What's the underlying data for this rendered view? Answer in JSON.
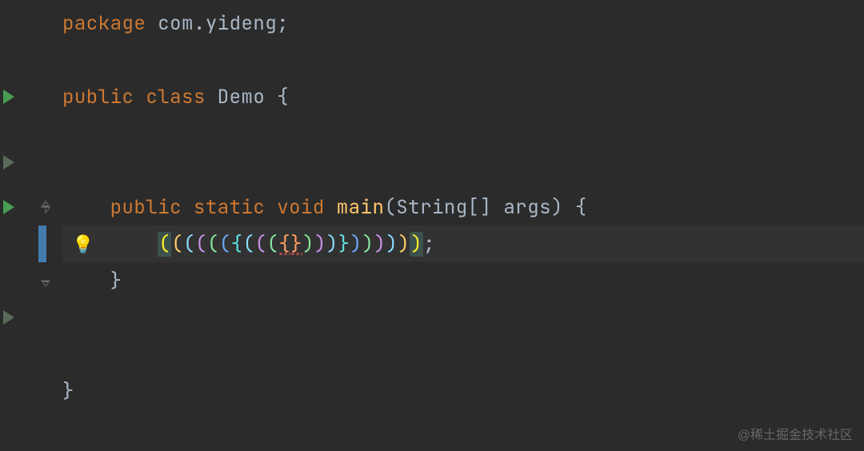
{
  "code": {
    "package_kw": "package",
    "package_name": "com.yideng",
    "semicolon": ";",
    "public_kw": "public",
    "class_kw": "class",
    "class_name": "Demo",
    "open_brace": "{",
    "close_brace": "}",
    "static_kw": "static",
    "void_kw": "void",
    "method_name": "main",
    "param_type": "String",
    "param_brackets": "[]",
    "param_name": "args"
  },
  "rainbow_brackets": {
    "chars": [
      "(",
      "(",
      "(",
      "(",
      "(",
      "(",
      "{",
      "(",
      "(",
      "(",
      "{",
      "}",
      ")",
      ")",
      ")",
      "}",
      ")",
      ")",
      ")",
      ")",
      ")",
      ")"
    ],
    "colors": [
      "hl",
      "rb0",
      "rb1",
      "rb2",
      "rb3",
      "rb4",
      "rb6",
      "rb1",
      "rb2",
      "rb3",
      "rb5",
      "rb5",
      "rb3",
      "rb2",
      "rb1",
      "rb6",
      "rb4",
      "rb3",
      "rb2",
      "rb1",
      "rb0",
      "hl"
    ],
    "trailing_semicolon": ";"
  },
  "icons": {
    "bulb": "💡"
  },
  "watermark": "@稀土掘金技术社区"
}
